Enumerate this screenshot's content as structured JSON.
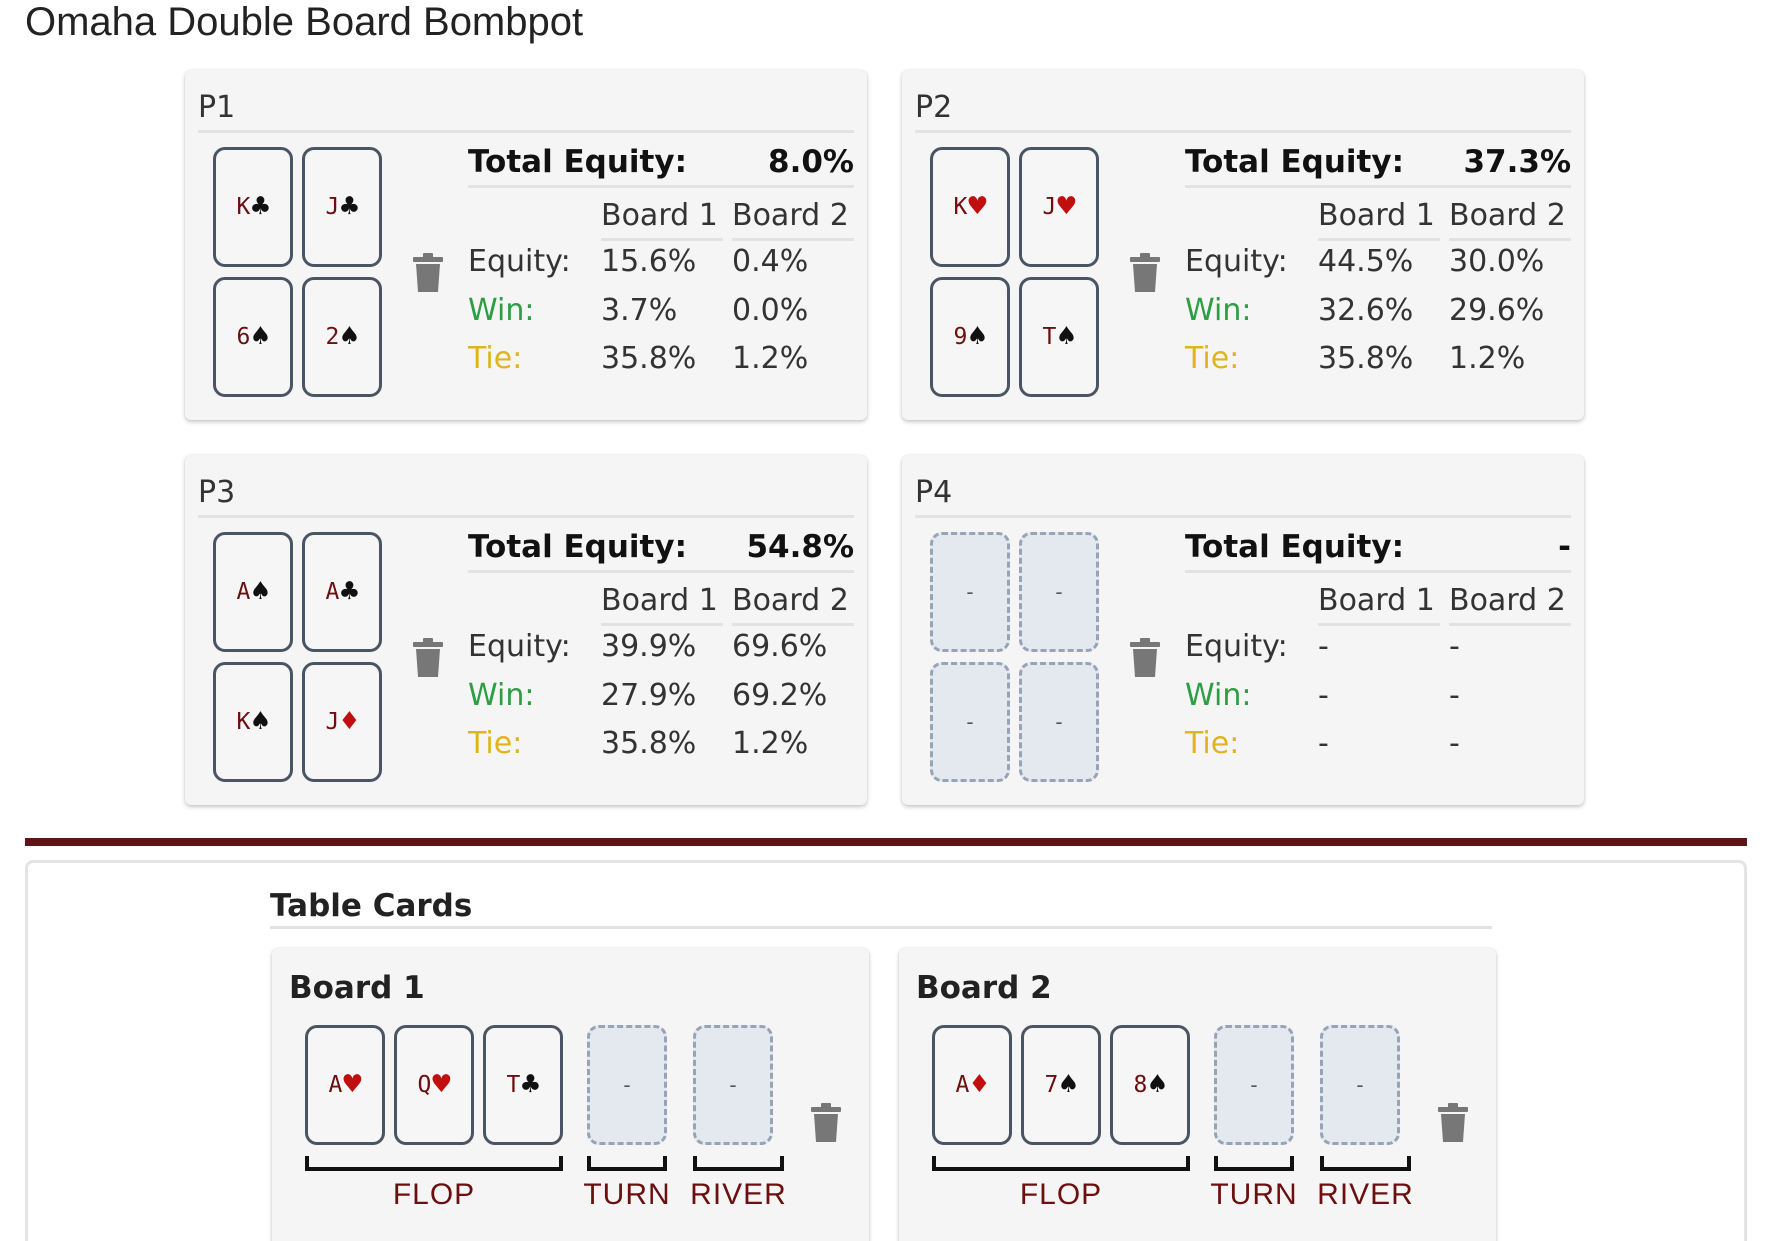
{
  "app": {
    "title": "Omaha Double Board Bombpot"
  },
  "labels": {
    "total_equity": "Total Equity:",
    "board1": "Board 1",
    "board2": "Board 2",
    "equity": "Equity:",
    "win": "Win:",
    "tie": "Tie:"
  },
  "colors": {
    "win_label": "#2e9e44",
    "tie_label": "#e0b41e",
    "card_border": "#4a5463",
    "rank_color": "#6b0f0f",
    "red_suit": "#c10e0e",
    "divider": "#5c1616"
  },
  "players": [
    {
      "name": "P1",
      "total_equity": "8.0%",
      "cards": [
        {
          "rank": "K",
          "suit": "♣",
          "color": "black"
        },
        {
          "rank": "J",
          "suit": "♣",
          "color": "black"
        },
        {
          "rank": "6",
          "suit": "♠",
          "color": "black"
        },
        {
          "rank": "2",
          "suit": "♠",
          "color": "black"
        }
      ],
      "board1": {
        "equity": "15.6%",
        "win": "3.7%",
        "tie": "35.8%"
      },
      "board2": {
        "equity": "0.4%",
        "win": "0.0%",
        "tie": "1.2%"
      }
    },
    {
      "name": "P2",
      "total_equity": "37.3%",
      "cards": [
        {
          "rank": "K",
          "suit": "♥",
          "color": "red"
        },
        {
          "rank": "J",
          "suit": "♥",
          "color": "red"
        },
        {
          "rank": "9",
          "suit": "♠",
          "color": "black"
        },
        {
          "rank": "T",
          "suit": "♠",
          "color": "black"
        }
      ],
      "board1": {
        "equity": "44.5%",
        "win": "32.6%",
        "tie": "35.8%"
      },
      "board2": {
        "equity": "30.0%",
        "win": "29.6%",
        "tie": "1.2%"
      }
    },
    {
      "name": "P3",
      "total_equity": "54.8%",
      "cards": [
        {
          "rank": "A",
          "suit": "♠",
          "color": "black"
        },
        {
          "rank": "A",
          "suit": "♣",
          "color": "black"
        },
        {
          "rank": "K",
          "suit": "♠",
          "color": "black"
        },
        {
          "rank": "J",
          "suit": "♦",
          "color": "red"
        }
      ],
      "board1": {
        "equity": "39.9%",
        "win": "27.9%",
        "tie": "35.8%"
      },
      "board2": {
        "equity": "69.6%",
        "win": "69.2%",
        "tie": "1.2%"
      }
    },
    {
      "name": "P4",
      "total_equity": "-",
      "cards": [
        {
          "empty": "-"
        },
        {
          "empty": "-"
        },
        {
          "empty": "-"
        },
        {
          "empty": "-"
        }
      ],
      "board1": {
        "equity": "-",
        "win": "-",
        "tie": "-"
      },
      "board2": {
        "equity": "-",
        "win": "-",
        "tie": "-"
      }
    }
  ],
  "table": {
    "title": "Table Cards",
    "streets": {
      "flop": "FLOP",
      "turn": "TURN",
      "river": "RIVER"
    },
    "boards": [
      {
        "title": "Board 1",
        "flop": [
          {
            "rank": "A",
            "suit": "♥",
            "color": "red"
          },
          {
            "rank": "Q",
            "suit": "♥",
            "color": "red"
          },
          {
            "rank": "T",
            "suit": "♣",
            "color": "black"
          }
        ],
        "turn": "-",
        "river": "-"
      },
      {
        "title": "Board 2",
        "flop": [
          {
            "rank": "A",
            "suit": "♦",
            "color": "red"
          },
          {
            "rank": "7",
            "suit": "♠",
            "color": "black"
          },
          {
            "rank": "8",
            "suit": "♠",
            "color": "black"
          }
        ],
        "turn": "-",
        "river": "-"
      }
    ]
  }
}
